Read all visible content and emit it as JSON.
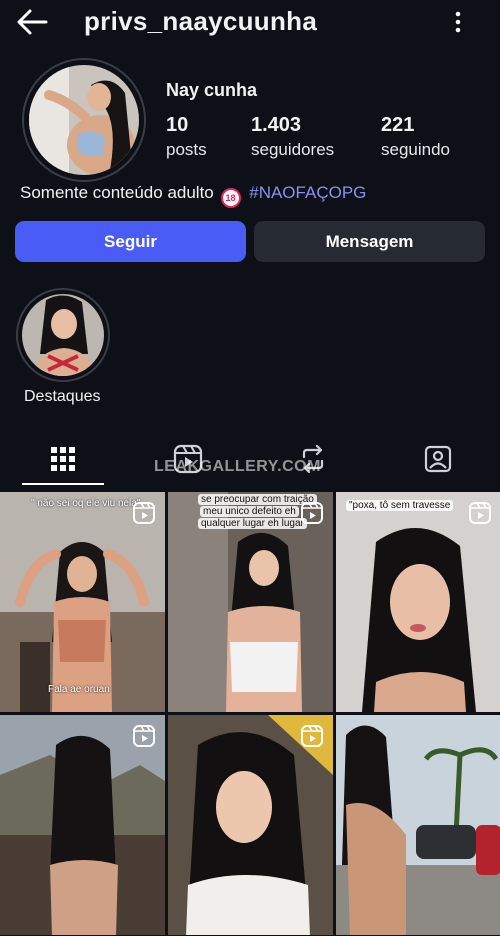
{
  "header": {
    "username": "privs_naaycuunha"
  },
  "profile": {
    "full_name": "Nay cunha",
    "stats": [
      {
        "value": "10",
        "label": "posts"
      },
      {
        "value": "1.403",
        "label": "seguidores"
      },
      {
        "value": "221",
        "label": "seguindo"
      }
    ],
    "bio_text": "Somente conteúdo adulto",
    "bio_emoji": "18",
    "bio_hashtag": "#NAOFAÇOPG"
  },
  "actions": {
    "follow_label": "Seguir",
    "message_label": "Mensagem"
  },
  "highlights": [
    {
      "label": "Destaques"
    }
  ],
  "tabs": [
    {
      "icon": "grid-icon"
    },
    {
      "icon": "reels-icon"
    },
    {
      "icon": "repost-icon"
    },
    {
      "icon": "tagged-icon"
    }
  ],
  "watermark": "LEAKGALLERY.COM",
  "grid": {
    "captions": {
      "p1": "\" não sei oq ele viu nela\"",
      "p1_bottom": "Fala ae oruan",
      "p2_line1": "se preocupar com traição",
      "p2_line2": "meu unico defeito eh",
      "p2_line3": "qualquer lugar eh lugar",
      "p3": "\"poxa, tô sem travesse"
    }
  },
  "colors": {
    "background": "#0d1016",
    "follow_button": "#4a5cf6",
    "message_button": "#262a33",
    "hashtag": "#8d8ff0"
  }
}
